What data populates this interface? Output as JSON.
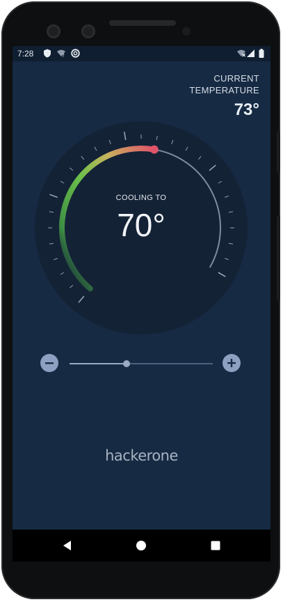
{
  "status_bar": {
    "time": "7:28"
  },
  "header": {
    "current_label_line1": "CURRENT",
    "current_label_line2": "TEMPERATURE",
    "current_value": "73°"
  },
  "dial": {
    "mode_label": "COOLING TO",
    "target_value": "70°",
    "min_temp": 50,
    "max_temp": 90,
    "target_temp": 70,
    "current_temp": 73,
    "colors": {
      "cool": "#4caf50",
      "warm": "#c9b45a",
      "hot": "#e0546a",
      "dial_bg": "#142236",
      "tick": "#b8c2d0"
    }
  },
  "slider": {
    "level_fraction": 0.4,
    "minus_icon": "minus-icon",
    "plus_icon": "plus-icon"
  },
  "brand": {
    "logo_text": "hackerone"
  },
  "nav": {
    "back_icon": "back-triangle-icon",
    "home_icon": "home-circle-icon",
    "recent_icon": "recent-square-icon"
  }
}
